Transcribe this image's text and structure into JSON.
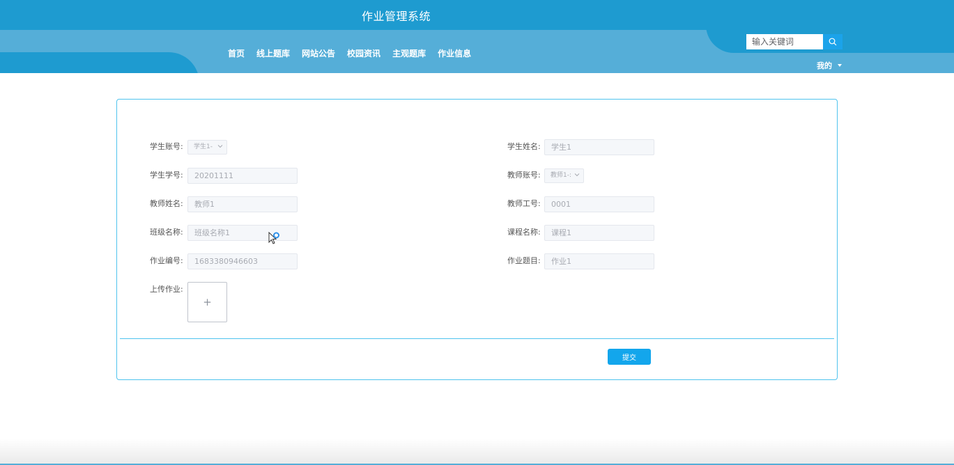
{
  "header": {
    "title": "作业管理系统",
    "nav": [
      "首页",
      "线上题库",
      "网站公告",
      "校园资讯",
      "主观题库",
      "作业信息"
    ],
    "search": {
      "placeholder": "输入关键词",
      "icon": "search-icon"
    },
    "user_menu": {
      "label": "我的",
      "icon": "caret-down-icon"
    }
  },
  "form": {
    "student_account": {
      "label": "学生账号:",
      "value": "学生1-"
    },
    "student_name": {
      "label": "学生姓名:",
      "value": "学生1"
    },
    "student_id": {
      "label": "学生学号:",
      "value": "20201111"
    },
    "teacher_account": {
      "label": "教师账号:",
      "value": "教师1-:"
    },
    "teacher_name": {
      "label": "教师姓名:",
      "value": "教师1"
    },
    "teacher_no": {
      "label": "教师工号:",
      "value": "0001"
    },
    "class_name": {
      "label": "班级名称:",
      "value": "班级名称1"
    },
    "course_name": {
      "label": "课程名称:",
      "value": "课程1"
    },
    "homework_no": {
      "label": "作业编号:",
      "value": "1683380946603"
    },
    "homework_title": {
      "label": "作业题目:",
      "value": "作业1"
    },
    "upload": {
      "label": "上传作业:",
      "icon": "plus-icon",
      "symbol": "+"
    },
    "submit_label": "提交"
  },
  "colors": {
    "header": "#1e9bd0",
    "nav_band": "#55aed8",
    "accent": "#13a6ec",
    "card_border": "#4fc3ee"
  }
}
